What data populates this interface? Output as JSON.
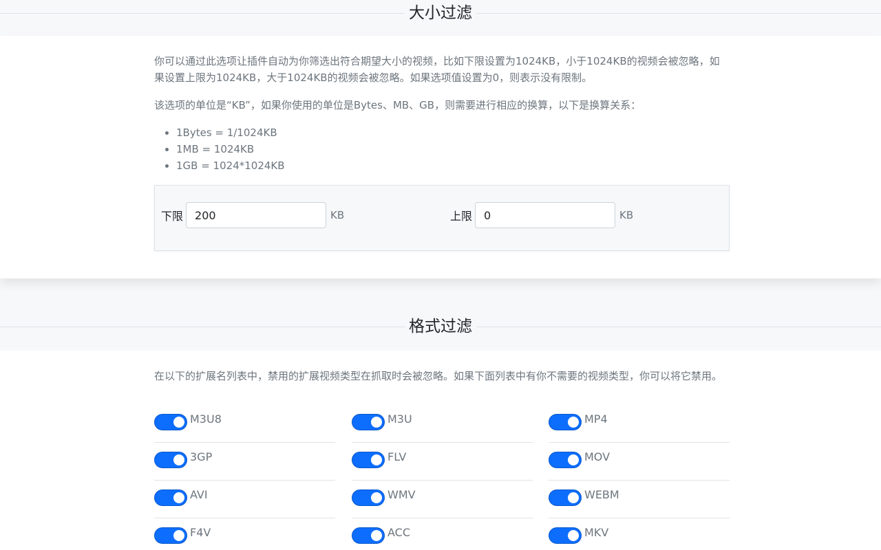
{
  "size_filter": {
    "title": "大小过滤",
    "description": "你可以通过此选项让插件自动为你筛选出符合期望大小的视频，比如下限设置为1024KB，小于1024KB的视频会被忽略，如果设置上限为1024KB，大于1024KB的视频会被忽略。如果选项值设置为0，则表示没有限制。",
    "unit_note": "该选项的单位是“KB”，如果你使用的单位是Bytes、MB、GB，则需要进行相应的换算，以下是换算关系：",
    "conversions": [
      "1Bytes = 1/1024KB",
      "1MB = 1024KB",
      "1GB = 1024*1024KB"
    ],
    "lower": {
      "label": "下限",
      "value": "200",
      "unit": "KB"
    },
    "upper": {
      "label": "上限",
      "value": "0",
      "unit": "KB"
    }
  },
  "format_filter": {
    "title": "格式过滤",
    "description": "在以下的扩展名列表中，禁用的扩展视频类型在抓取时会被忽略。如果下面列表中有你不需要的视频类型，你可以将它禁用。",
    "formats": [
      {
        "name": "M3U8",
        "enabled": true
      },
      {
        "name": "M3U",
        "enabled": true
      },
      {
        "name": "MP4",
        "enabled": true
      },
      {
        "name": "3GP",
        "enabled": true
      },
      {
        "name": "FLV",
        "enabled": true
      },
      {
        "name": "MOV",
        "enabled": true
      },
      {
        "name": "AVI",
        "enabled": true
      },
      {
        "name": "WMV",
        "enabled": true
      },
      {
        "name": "WEBM",
        "enabled": true
      },
      {
        "name": "F4V",
        "enabled": true
      },
      {
        "name": "ACC",
        "enabled": true
      },
      {
        "name": "MKV",
        "enabled": true
      }
    ]
  },
  "colors": {
    "accent": "#0d6efd",
    "text_muted": "#6c757d",
    "heading": "#212529"
  }
}
